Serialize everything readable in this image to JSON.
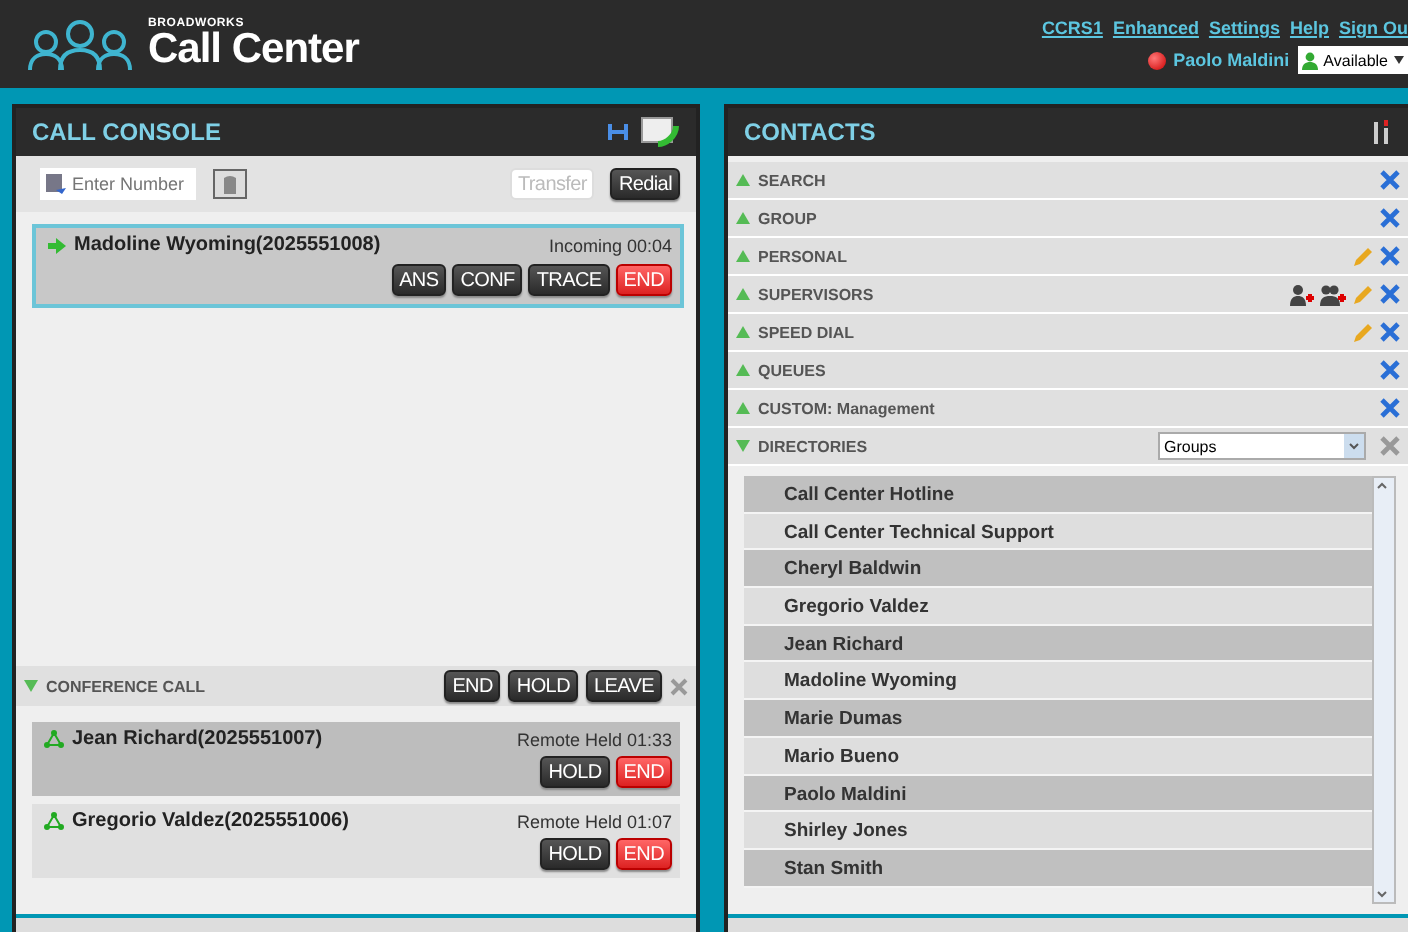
{
  "header": {
    "brand_small": "BROADWORKS",
    "brand": "Call Center",
    "links": [
      "CCRS1",
      "Enhanced",
      "Settings",
      "Help",
      "Sign Ou"
    ],
    "user": "Paolo Maldini",
    "presence": "Available"
  },
  "call_console": {
    "title": "CALL CONSOLE",
    "dial": {
      "placeholder": "Enter Number"
    },
    "toolbar_buttons": [
      {
        "label": "Transfer",
        "disabled": true
      },
      {
        "label": "Redial",
        "disabled": false
      }
    ],
    "calls": [
      {
        "name": "Madoline Wyoming(2025551008)",
        "status": "Incoming 00:04",
        "buttons": [
          {
            "label": "ANS",
            "kind": "normal"
          },
          {
            "label": "CONF",
            "kind": "normal"
          },
          {
            "label": "TRACE",
            "kind": "normal"
          },
          {
            "label": "END",
            "kind": "danger"
          }
        ]
      }
    ],
    "conference": {
      "title": "CONFERENCE CALL",
      "expanded": true,
      "buttons": [
        {
          "label": "END",
          "kind": "normal"
        },
        {
          "label": "HOLD",
          "kind": "normal"
        },
        {
          "label": "LEAVE",
          "kind": "normal"
        }
      ],
      "participants": [
        {
          "name": "Jean Richard(2025551007)",
          "status": "Remote Held 01:33",
          "selected": true,
          "buttons": [
            {
              "label": "HOLD",
              "kind": "normal"
            },
            {
              "label": "END",
              "kind": "danger"
            }
          ]
        },
        {
          "name": "Gregorio Valdez(2025551006)",
          "status": "Remote Held 01:07",
          "selected": false,
          "buttons": [
            {
              "label": "HOLD",
              "kind": "normal"
            },
            {
              "label": "END",
              "kind": "danger"
            }
          ]
        }
      ]
    }
  },
  "contacts": {
    "title": "CONTACTS",
    "sections": [
      {
        "label": "SEARCH",
        "expanded": false,
        "actions": [
          {
            "kind": "close"
          }
        ]
      },
      {
        "label": "GROUP",
        "expanded": false,
        "actions": [
          {
            "kind": "close"
          }
        ]
      },
      {
        "label": "PERSONAL",
        "expanded": false,
        "actions": [
          {
            "kind": "edit"
          },
          {
            "kind": "close"
          }
        ]
      },
      {
        "label": "SUPERVISORS",
        "expanded": false,
        "actions": [
          {
            "kind": "add-person"
          },
          {
            "kind": "add-group"
          },
          {
            "kind": "edit"
          },
          {
            "kind": "close"
          }
        ]
      },
      {
        "label": "SPEED DIAL",
        "expanded": false,
        "actions": [
          {
            "kind": "edit"
          },
          {
            "kind": "close"
          }
        ]
      },
      {
        "label": "QUEUES",
        "expanded": false,
        "actions": [
          {
            "kind": "close"
          }
        ]
      },
      {
        "label": "CUSTOM: Management",
        "expanded": false,
        "actions": [
          {
            "kind": "close"
          }
        ]
      },
      {
        "label": "DIRECTORIES",
        "expanded": true,
        "actions": [
          {
            "kind": "close-grey"
          }
        ],
        "dropdown": "Groups"
      }
    ],
    "directory": [
      "Call Center Hotline",
      "Call Center Technical Support",
      "Cheryl Baldwin",
      "Gregorio Valdez",
      "Jean Richard",
      "Madoline Wyoming",
      "Marie Dumas",
      "Mario Bueno",
      "Paolo Maldini",
      "Shirley Jones",
      "Stan Smith"
    ]
  }
}
